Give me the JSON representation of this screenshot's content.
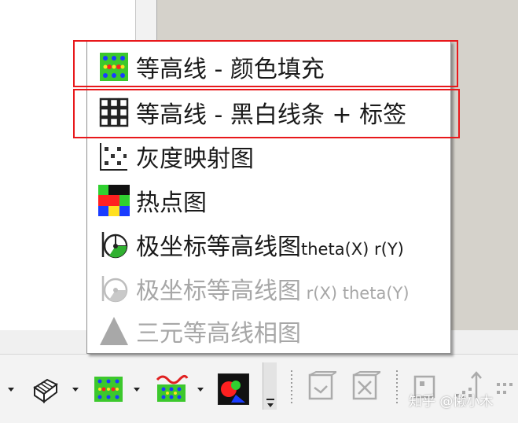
{
  "menu": {
    "items": [
      {
        "id": "contour-color-fill",
        "label": "等高线 - 颜色填充",
        "icon": "contour-color-icon",
        "enabled": true,
        "highlighted": true
      },
      {
        "id": "contour-bw-lines",
        "label": "等高线 - 黑白线条 + 标签",
        "icon": "contour-bw-icon",
        "enabled": true,
        "highlighted": true
      },
      {
        "id": "grayscale-map",
        "label": "灰度映射图",
        "icon": "grayscale-map-icon",
        "enabled": true,
        "highlighted": false
      },
      {
        "id": "heatmap",
        "label": "热点图",
        "icon": "heatmap-icon",
        "enabled": true,
        "highlighted": false
      },
      {
        "id": "polar-contour-theta-r",
        "label_cn": "极坐标等高线图",
        "label_latin": "theta(X) r(Y)",
        "icon": "polar-contour-icon",
        "enabled": true,
        "highlighted": false
      },
      {
        "id": "polar-contour-r-theta",
        "label_cn": "极坐标等高线图",
        "label_latin": " r(X) theta(Y)",
        "icon": "polar-contour-disabled-icon",
        "enabled": false,
        "highlighted": false
      },
      {
        "id": "ternary-contour",
        "label": "三元等高线相图",
        "icon": "triangle-icon",
        "enabled": false,
        "highlighted": false
      }
    ]
  },
  "toolbar": {
    "icons": [
      "3d-surface-icon",
      "contour-color-icon",
      "contour-lines-icon",
      "heatmap-icon",
      "expand-icon",
      "cube-plot-icon",
      "cube-plot-2-icon",
      "stat-plot-icon",
      "bar-plot-icon"
    ]
  },
  "watermark": "知乎 @懒小木",
  "colors": {
    "highlight_border": "#e8181b",
    "disabled_text": "#a7a7a7"
  }
}
